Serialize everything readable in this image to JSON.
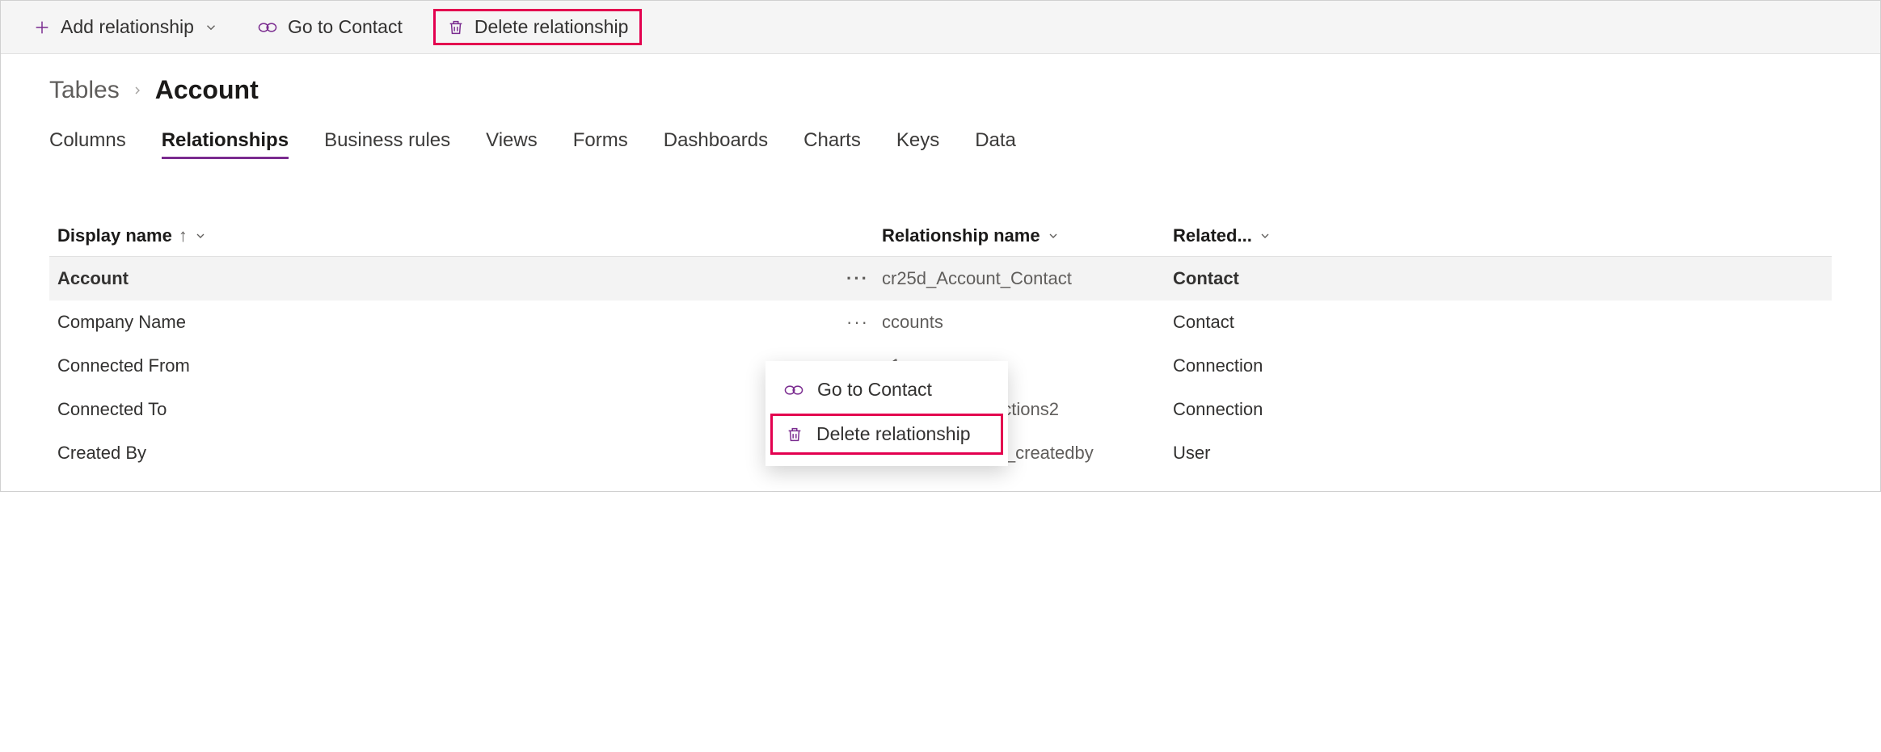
{
  "toolbar": {
    "add_label": "Add relationship",
    "goto_label": "Go to Contact",
    "delete_label": "Delete relationship"
  },
  "breadcrumb": {
    "root": "Tables",
    "current": "Account"
  },
  "tabs": [
    {
      "label": "Columns"
    },
    {
      "label": "Relationships"
    },
    {
      "label": "Business rules"
    },
    {
      "label": "Views"
    },
    {
      "label": "Forms"
    },
    {
      "label": "Dashboards"
    },
    {
      "label": "Charts"
    },
    {
      "label": "Keys"
    },
    {
      "label": "Data"
    }
  ],
  "columns": {
    "display_name": "Display name",
    "relationship_name": "Relationship name",
    "related": "Related..."
  },
  "rows": [
    {
      "display": "Account",
      "rel": "cr25d_Account_Contact",
      "related": "Contact"
    },
    {
      "display": "Company Name",
      "rel": "ccounts",
      "related": "Contact"
    },
    {
      "display": "Connected From",
      "rel": "s1",
      "related": "Connection"
    },
    {
      "display": "Connected To",
      "rel": "account_connections2",
      "related": "Connection"
    },
    {
      "display": "Created By",
      "rel": "lk_accountbase_createdby",
      "related": "User"
    }
  ],
  "context_menu": {
    "goto": "Go to Contact",
    "delete": "Delete relationship"
  }
}
